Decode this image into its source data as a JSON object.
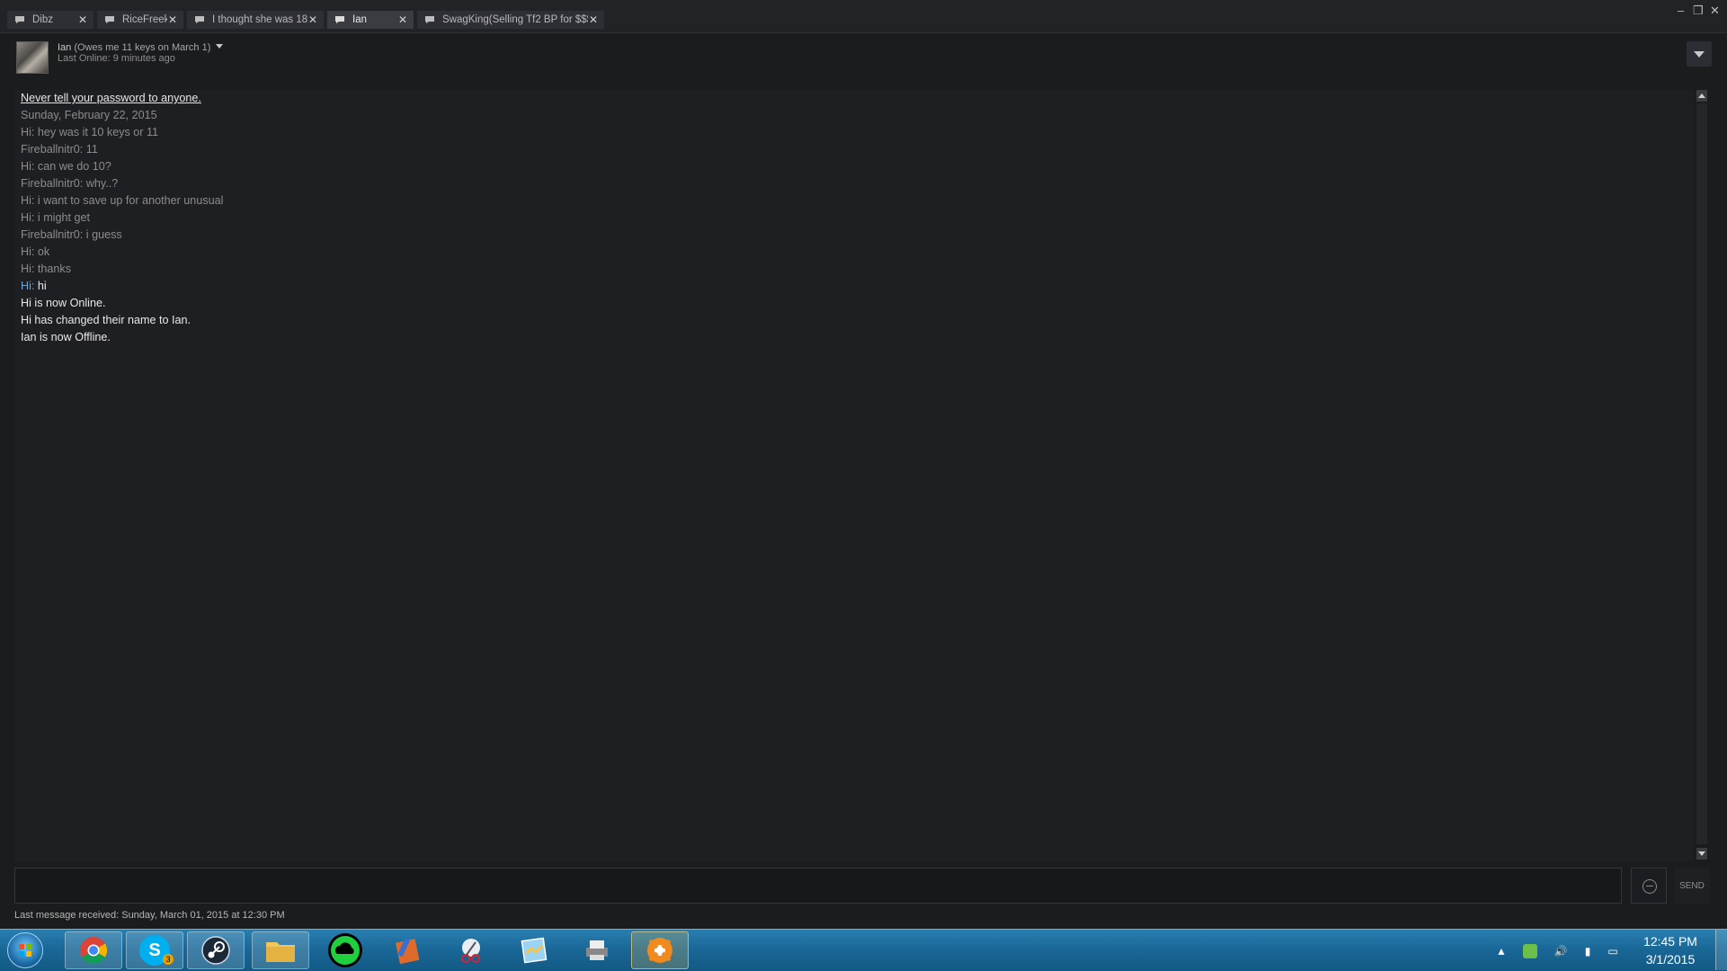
{
  "tabs": [
    {
      "label": "Dibz",
      "active": false
    },
    {
      "label": "RiceFreek",
      "active": false
    },
    {
      "label": "I thought she was 18...",
      "active": false
    },
    {
      "label": "Ian",
      "active": true
    },
    {
      "label": "SwagKing(Selling Tf2 BP for $$$)",
      "active": false
    }
  ],
  "window_controls": {
    "minimize": "–",
    "restore": "❐",
    "close": "✕"
  },
  "header": {
    "name": "Ian",
    "nickname": "(Owes me 11 keys on March 1)",
    "status": "Last Online: 9 minutes ago"
  },
  "chat": {
    "warning": "Never tell your password to anyone.",
    "date": "Sunday, February 22, 2015",
    "messages": [
      {
        "text": "Hi: hey was it 10 keys or 11"
      },
      {
        "text": "Fireballnitr0: 11"
      },
      {
        "text": "Hi: can we do 10?"
      },
      {
        "text": "Fireballnitr0: why..?"
      },
      {
        "text": "Hi: i want to save up for another unusual"
      },
      {
        "text": "Hi: i might get"
      },
      {
        "text": "Fireballnitr0: i guess"
      },
      {
        "text": "Hi: ok"
      },
      {
        "text": "Hi: thanks"
      }
    ],
    "recent": {
      "sender": "Hi",
      "sep": ":",
      "text": " hi"
    },
    "events": [
      "Hi is now Online.",
      "Hi has changed their name to Ian.",
      "Ian is now Offline."
    ]
  },
  "input": {
    "placeholder": "",
    "send_label": "SEND"
  },
  "footer": {
    "last_message": "Last message received: Sunday, March 01, 2015 at 12:30 PM"
  },
  "taskbar": {
    "apps": [
      {
        "name": "chrome-icon",
        "glyph": ""
      },
      {
        "name": "skype-icon",
        "glyph": "S"
      },
      {
        "name": "steam-icon",
        "glyph": ""
      },
      {
        "name": "file-explorer-icon",
        "glyph": ""
      },
      {
        "name": "cloud-app-icon",
        "glyph": ""
      },
      {
        "name": "paint-app-icon",
        "glyph": ""
      },
      {
        "name": "snipping-tool-icon",
        "glyph": ""
      },
      {
        "name": "maps-app-icon",
        "glyph": ""
      },
      {
        "name": "printer-app-icon",
        "glyph": ""
      },
      {
        "name": "avast-icon",
        "glyph": ""
      }
    ],
    "skype_badge": "3",
    "clock": {
      "time": "12:45 PM",
      "date": "3/1/2015"
    }
  },
  "colors": {
    "accent_blue": "#5aa9e0",
    "taskbar": "#1a6898"
  }
}
